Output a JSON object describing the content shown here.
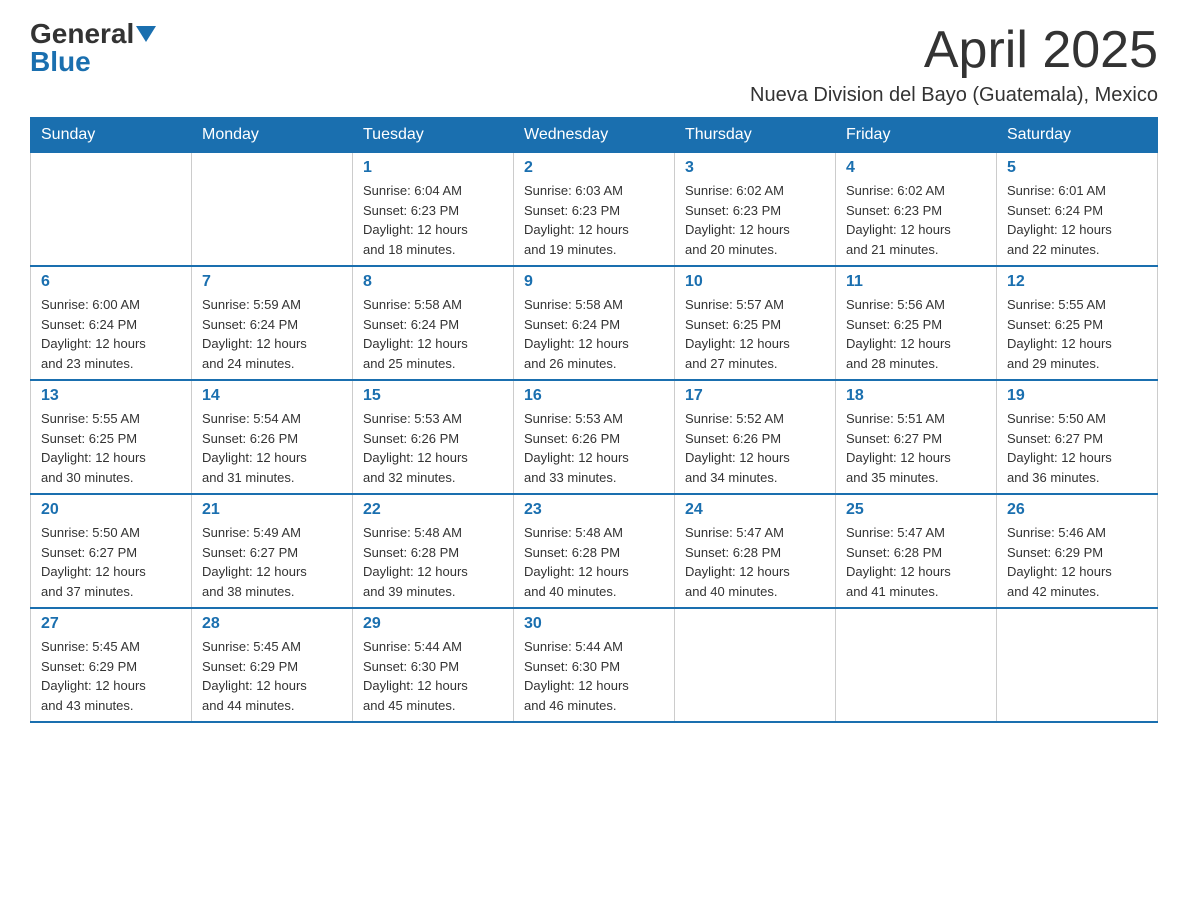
{
  "logo": {
    "general": "General",
    "blue": "Blue"
  },
  "title": "April 2025",
  "subtitle": "Nueva Division del Bayo (Guatemala), Mexico",
  "weekdays": [
    "Sunday",
    "Monday",
    "Tuesday",
    "Wednesday",
    "Thursday",
    "Friday",
    "Saturday"
  ],
  "weeks": [
    [
      {
        "day": "",
        "info": ""
      },
      {
        "day": "",
        "info": ""
      },
      {
        "day": "1",
        "info": "Sunrise: 6:04 AM\nSunset: 6:23 PM\nDaylight: 12 hours\nand 18 minutes."
      },
      {
        "day": "2",
        "info": "Sunrise: 6:03 AM\nSunset: 6:23 PM\nDaylight: 12 hours\nand 19 minutes."
      },
      {
        "day": "3",
        "info": "Sunrise: 6:02 AM\nSunset: 6:23 PM\nDaylight: 12 hours\nand 20 minutes."
      },
      {
        "day": "4",
        "info": "Sunrise: 6:02 AM\nSunset: 6:23 PM\nDaylight: 12 hours\nand 21 minutes."
      },
      {
        "day": "5",
        "info": "Sunrise: 6:01 AM\nSunset: 6:24 PM\nDaylight: 12 hours\nand 22 minutes."
      }
    ],
    [
      {
        "day": "6",
        "info": "Sunrise: 6:00 AM\nSunset: 6:24 PM\nDaylight: 12 hours\nand 23 minutes."
      },
      {
        "day": "7",
        "info": "Sunrise: 5:59 AM\nSunset: 6:24 PM\nDaylight: 12 hours\nand 24 minutes."
      },
      {
        "day": "8",
        "info": "Sunrise: 5:58 AM\nSunset: 6:24 PM\nDaylight: 12 hours\nand 25 minutes."
      },
      {
        "day": "9",
        "info": "Sunrise: 5:58 AM\nSunset: 6:24 PM\nDaylight: 12 hours\nand 26 minutes."
      },
      {
        "day": "10",
        "info": "Sunrise: 5:57 AM\nSunset: 6:25 PM\nDaylight: 12 hours\nand 27 minutes."
      },
      {
        "day": "11",
        "info": "Sunrise: 5:56 AM\nSunset: 6:25 PM\nDaylight: 12 hours\nand 28 minutes."
      },
      {
        "day": "12",
        "info": "Sunrise: 5:55 AM\nSunset: 6:25 PM\nDaylight: 12 hours\nand 29 minutes."
      }
    ],
    [
      {
        "day": "13",
        "info": "Sunrise: 5:55 AM\nSunset: 6:25 PM\nDaylight: 12 hours\nand 30 minutes."
      },
      {
        "day": "14",
        "info": "Sunrise: 5:54 AM\nSunset: 6:26 PM\nDaylight: 12 hours\nand 31 minutes."
      },
      {
        "day": "15",
        "info": "Sunrise: 5:53 AM\nSunset: 6:26 PM\nDaylight: 12 hours\nand 32 minutes."
      },
      {
        "day": "16",
        "info": "Sunrise: 5:53 AM\nSunset: 6:26 PM\nDaylight: 12 hours\nand 33 minutes."
      },
      {
        "day": "17",
        "info": "Sunrise: 5:52 AM\nSunset: 6:26 PM\nDaylight: 12 hours\nand 34 minutes."
      },
      {
        "day": "18",
        "info": "Sunrise: 5:51 AM\nSunset: 6:27 PM\nDaylight: 12 hours\nand 35 minutes."
      },
      {
        "day": "19",
        "info": "Sunrise: 5:50 AM\nSunset: 6:27 PM\nDaylight: 12 hours\nand 36 minutes."
      }
    ],
    [
      {
        "day": "20",
        "info": "Sunrise: 5:50 AM\nSunset: 6:27 PM\nDaylight: 12 hours\nand 37 minutes."
      },
      {
        "day": "21",
        "info": "Sunrise: 5:49 AM\nSunset: 6:27 PM\nDaylight: 12 hours\nand 38 minutes."
      },
      {
        "day": "22",
        "info": "Sunrise: 5:48 AM\nSunset: 6:28 PM\nDaylight: 12 hours\nand 39 minutes."
      },
      {
        "day": "23",
        "info": "Sunrise: 5:48 AM\nSunset: 6:28 PM\nDaylight: 12 hours\nand 40 minutes."
      },
      {
        "day": "24",
        "info": "Sunrise: 5:47 AM\nSunset: 6:28 PM\nDaylight: 12 hours\nand 40 minutes."
      },
      {
        "day": "25",
        "info": "Sunrise: 5:47 AM\nSunset: 6:28 PM\nDaylight: 12 hours\nand 41 minutes."
      },
      {
        "day": "26",
        "info": "Sunrise: 5:46 AM\nSunset: 6:29 PM\nDaylight: 12 hours\nand 42 minutes."
      }
    ],
    [
      {
        "day": "27",
        "info": "Sunrise: 5:45 AM\nSunset: 6:29 PM\nDaylight: 12 hours\nand 43 minutes."
      },
      {
        "day": "28",
        "info": "Sunrise: 5:45 AM\nSunset: 6:29 PM\nDaylight: 12 hours\nand 44 minutes."
      },
      {
        "day": "29",
        "info": "Sunrise: 5:44 AM\nSunset: 6:30 PM\nDaylight: 12 hours\nand 45 minutes."
      },
      {
        "day": "30",
        "info": "Sunrise: 5:44 AM\nSunset: 6:30 PM\nDaylight: 12 hours\nand 46 minutes."
      },
      {
        "day": "",
        "info": ""
      },
      {
        "day": "",
        "info": ""
      },
      {
        "day": "",
        "info": ""
      }
    ]
  ]
}
